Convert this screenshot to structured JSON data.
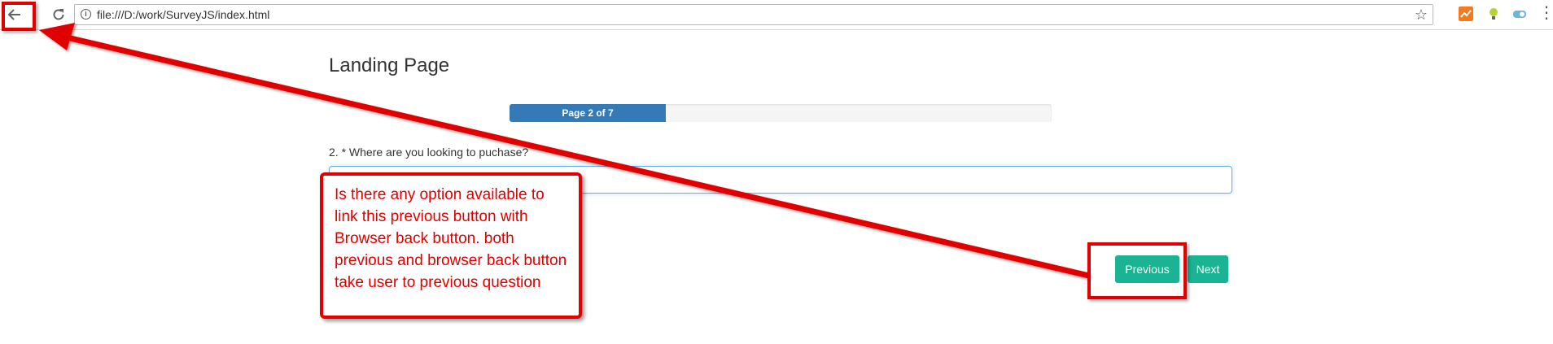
{
  "browser": {
    "url": "file:///D:/work/SurveyJS/index.html",
    "icons": {
      "back": "back-arrow-icon",
      "reload": "reload-icon",
      "info": "info-icon",
      "bookmark": "star-icon",
      "menu": "more-vert-icon"
    }
  },
  "survey": {
    "title": "Landing Page",
    "progress": {
      "text": "Page 2 of 7",
      "current": 2,
      "total": 7
    },
    "question": {
      "title": "2. * Where are you looking to puchase?",
      "value": ""
    },
    "buttons": {
      "previous": "Previous",
      "next": "Next"
    }
  },
  "annotation": {
    "callout": "Is there any option available to link this previous button with Browser back button. both previous and browser back button take user to previous question",
    "color": "#e00000"
  },
  "colors": {
    "progress_fill": "#337ab7",
    "button": "#1ab394"
  }
}
